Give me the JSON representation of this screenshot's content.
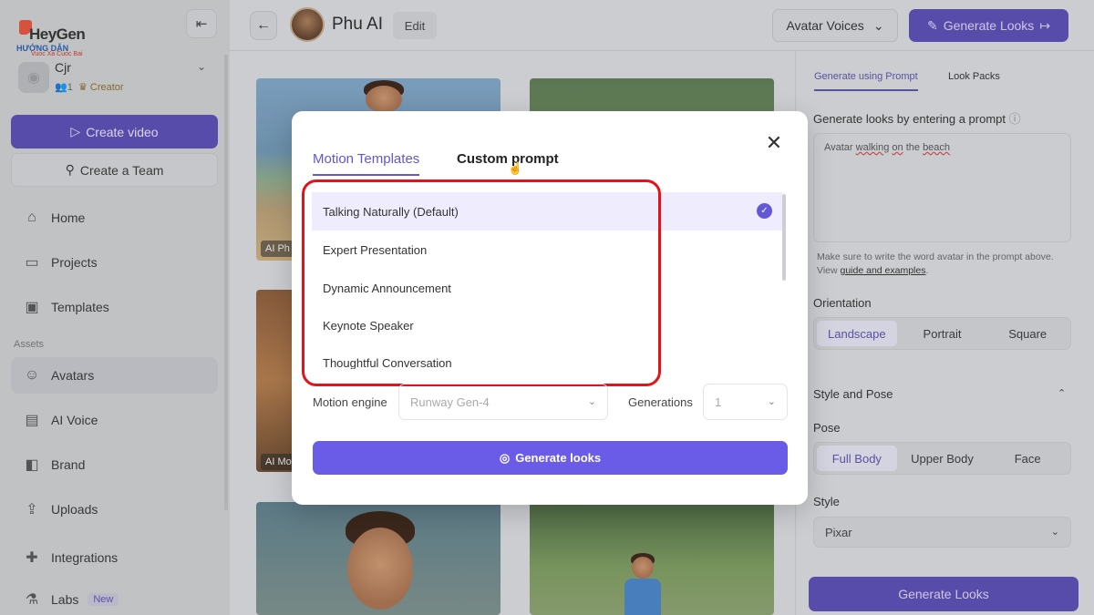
{
  "logo": {
    "name": "HeyGen",
    "sub1": "HƯỚNG DẪN",
    "sub2": "Vuoc Xa Cuoc Bai"
  },
  "workspace": {
    "name": "Cjr",
    "members": "1",
    "role": "Creator"
  },
  "sidebar": {
    "create_video": "Create video",
    "create_team": "Create a Team",
    "assets_label": "Assets",
    "items": [
      {
        "label": "Home",
        "icon": "home-icon"
      },
      {
        "label": "Projects",
        "icon": "folder-icon"
      },
      {
        "label": "Templates",
        "icon": "templates-icon"
      },
      {
        "label": "Avatars",
        "icon": "avatar-icon"
      },
      {
        "label": "AI Voice",
        "icon": "voice-icon"
      },
      {
        "label": "Brand",
        "icon": "brand-icon"
      },
      {
        "label": "Uploads",
        "icon": "upload-icon"
      },
      {
        "label": "Integrations",
        "icon": "puzzle-icon"
      },
      {
        "label": "Labs",
        "icon": "flask-icon",
        "badge": "New"
      }
    ]
  },
  "header": {
    "title": "Phu AI",
    "edit_label": "Edit",
    "voice_dropdown": "Avatar Voices",
    "generate_label": "Generate Looks"
  },
  "thumbs": {
    "tag1": "AI Ph",
    "tag2": "AI Mo"
  },
  "right_panel": {
    "tab_prompt": "Generate using Prompt",
    "tab_packs": "Look Packs",
    "prompt_label": "Generate looks by entering a prompt",
    "prompt_prefix": "Avatar ",
    "prompt_word1": "walking",
    "prompt_mid": " ",
    "prompt_word2": "on",
    "prompt_mid2": " the ",
    "prompt_word3": "beach",
    "hint_text": "Make sure to write the word avatar in the prompt above. View ",
    "hint_link": "guide and examples",
    "hint_end": ".",
    "orientation_label": "Orientation",
    "orientation_options": [
      "Landscape",
      "Portrait",
      "Square"
    ],
    "style_pose_label": "Style and Pose",
    "pose_label": "Pose",
    "pose_options": [
      "Full Body",
      "Upper Body",
      "Face"
    ],
    "style_label": "Style",
    "style_value": "Pixar",
    "generate_label": "Generate Looks"
  },
  "modal": {
    "tab_templates": "Motion Templates",
    "tab_custom": "Custom prompt",
    "templates": [
      "Talking Naturally (Default)",
      "Expert Presentation",
      "Dynamic Announcement",
      "Keynote Speaker",
      "Thoughtful Conversation"
    ],
    "engine_label": "Motion engine",
    "engine_value": "Runway Gen-4",
    "generations_label": "Generations",
    "generations_value": "1",
    "generate_label": "Generate looks"
  },
  "colors": {
    "accent": "#6257d6",
    "highlight": "#e3131a"
  }
}
